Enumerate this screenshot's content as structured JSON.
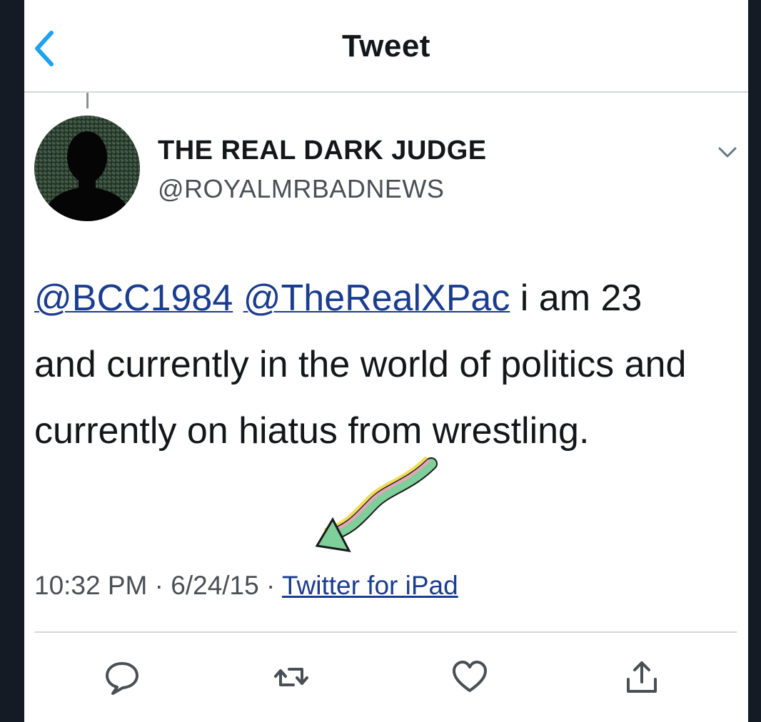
{
  "header": {
    "title": "Tweet",
    "back_icon": "chevron-left-icon"
  },
  "author": {
    "display_name": "THE REAL DARK JUDGE",
    "handle": "@ROYALMRBADNEWS",
    "avatar": "silhouette-avatar"
  },
  "tweet": {
    "mentions": [
      "@BCC1984",
      "@TheRealXPac"
    ],
    "text_line1_rest": " i am 23",
    "text_rest": "and currently in the world of politics and currently on hiatus from wrestling."
  },
  "meta": {
    "time": "10:32 PM",
    "separator": " · ",
    "date": "6/24/15",
    "source": "Twitter for iPad"
  },
  "actions": [
    {
      "name": "reply",
      "icon": "reply-icon"
    },
    {
      "name": "retweet",
      "icon": "retweet-icon"
    },
    {
      "name": "like",
      "icon": "heart-icon"
    },
    {
      "name": "share",
      "icon": "share-icon"
    }
  ],
  "colors": {
    "accent": "#1da1f2",
    "link": "#1b3d8f",
    "text": "#14171a",
    "secondary": "#4a4f55",
    "background": "#141b24"
  }
}
